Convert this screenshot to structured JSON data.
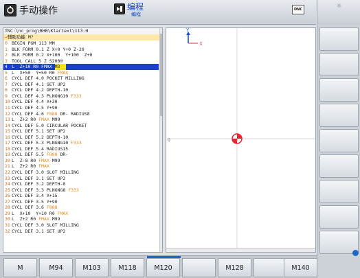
{
  "header": {
    "mode_title": "手动操作",
    "prog_title": "编程",
    "prog_subtitle": "编程",
    "dnc_label": "DNC",
    "mode_icon": "operating-mode-icon",
    "prog_icon": "programming-mode-icon"
  },
  "program": {
    "path": "TNC:\\nc_prog\\BHB\\Klartext\\113.H",
    "func_prefix": "→",
    "func_line": "辅助功能 M?",
    "selected_index": 4,
    "cursor_text": "M3",
    "lines": [
      {
        "n": "0",
        "t": "BEGIN PGM 113 MM"
      },
      {
        "n": "1",
        "t": "BLK FORM 0.1 Z X+0 Y+0 Z-20"
      },
      {
        "n": "2",
        "t": "BLK FORM 0.2 X+100  Y+100  Z+0"
      },
      {
        "n": "3",
        "t": "TOOL CALL 5 Z S2000"
      },
      {
        "n": "4",
        "t": "L  Z+10 R0 FMAX "
      },
      {
        "n": "5",
        "t": "L  X+50  Y+50 R0 ",
        "kw": "FMAX"
      },
      {
        "n": "6",
        "t": "CYCL DEF 4.0 POCKET MILLING"
      },
      {
        "n": "7",
        "t": "CYCL DEF 4.1 SET UP2"
      },
      {
        "n": "8",
        "t": "CYCL DEF 4.2 DEPTH-10"
      },
      {
        "n": "9",
        "t": "CYCL DEF 4.3 PLNGNG10 ",
        "kw": "F333"
      },
      {
        "n": "10",
        "t": "CYCL DEF 4.4 X+30"
      },
      {
        "n": "11",
        "t": "CYCL DEF 4.5 Y+90"
      },
      {
        "n": "12",
        "t": "CYCL DEF 4.6 ",
        "kw": "F888",
        "t2": " DR- RADIUS8"
      },
      {
        "n": "13",
        "t": "L  Z+2 R0 ",
        "kw": "FMAX",
        "t2": " M99"
      },
      {
        "n": "14",
        "t": "CYCL DEF 5.0 CIRCULAR POCKET"
      },
      {
        "n": "15",
        "t": "CYCL DEF 5.1 SET UP2"
      },
      {
        "n": "16",
        "t": "CYCL DEF 5.2 DEPTH-10"
      },
      {
        "n": "17",
        "t": "CYCL DEF 5.3 PLNGNG10 ",
        "kw": "F333"
      },
      {
        "n": "18",
        "t": "CYCL DEF 5.4 RADIUS15"
      },
      {
        "n": "19",
        "t": "CYCL DEF 5.5 ",
        "kw": "F888",
        "t2": " DR-"
      },
      {
        "n": "20",
        "t": "L  Z-8 R0 ",
        "kw": "FMAX",
        "t2": " M99"
      },
      {
        "n": "21",
        "t": "L  Z+2 R0 ",
        "kw": "FMAX"
      },
      {
        "n": "22",
        "t": "CYCL DEF 3.0 SLOT MILLING"
      },
      {
        "n": "23",
        "t": "CYCL DEF 3.1 SET UP2"
      },
      {
        "n": "24",
        "t": "CYCL DEF 3.2 DEPTH-8"
      },
      {
        "n": "25",
        "t": "CYCL DEF 3.3 PLNGNG8 ",
        "kw": "F333"
      },
      {
        "n": "26",
        "t": "CYCL DEF 3.4 X+15"
      },
      {
        "n": "27",
        "t": "CYCL DEF 3.5 Y+90"
      },
      {
        "n": "28",
        "t": "CYCL DEF 3.6 ",
        "kw": "F888"
      },
      {
        "n": "29",
        "t": "L  X+10  Y+10 R0 ",
        "kw": "FMAX"
      },
      {
        "n": "30",
        "t": "L  Z+2 R0 ",
        "kw": "FMAX",
        "t2": " M99"
      },
      {
        "n": "31",
        "t": "CYCL DEF 3.0 SLOT MILLING"
      },
      {
        "n": "32",
        "t": "CYCL DEF 3.1 SET UP2"
      }
    ]
  },
  "graphics": {
    "axis_x": "X",
    "axis_y": "Y",
    "marker_label": "0",
    "axis_color_x": "#e0505a",
    "axis_color_y": "#1d4fd8",
    "target_color": "#e8252e"
  },
  "softkeys": [
    {
      "label": "M"
    },
    {
      "label": "M94"
    },
    {
      "label": "M103"
    },
    {
      "label": "M118"
    },
    {
      "label": "M120"
    },
    {
      "label": ""
    },
    {
      "label": "M128"
    },
    {
      "label": ""
    },
    {
      "label": "M140"
    }
  ],
  "right_softkeys": [
    "",
    "",
    "",
    "",
    "",
    "",
    "",
    "",
    ""
  ]
}
